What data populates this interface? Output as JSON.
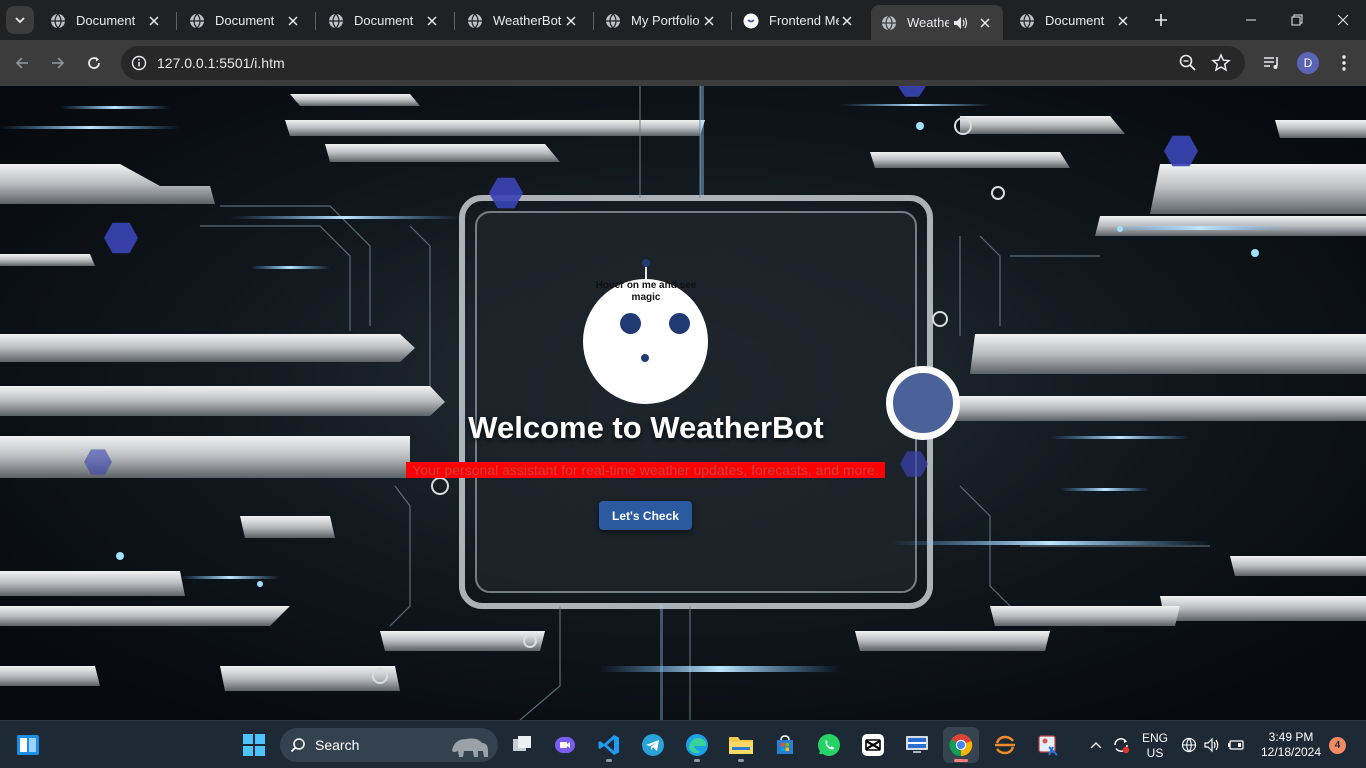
{
  "browser": {
    "tabs": [
      {
        "title": "Document"
      },
      {
        "title": "Document"
      },
      {
        "title": "Document"
      },
      {
        "title": "WeatherBot"
      },
      {
        "title": "My Portfolio"
      },
      {
        "title": "Frontend Me"
      },
      {
        "title": "Weather"
      },
      {
        "title": "Document"
      }
    ],
    "url": "127.0.0.1:5501/i.htm",
    "profile_initial": "D"
  },
  "page": {
    "bot_hint": "Hover on me and see magic",
    "headline": "Welcome to WeatherBot",
    "tagline": "Your personal assistant for real-time weather updates, forecasts, and more.",
    "cta_label": "Let's Check"
  },
  "taskbar": {
    "search_label": "Search",
    "language": "ENG",
    "region": "US",
    "time": "3:49 PM",
    "date": "12/18/2024",
    "notification_count": "4"
  },
  "colors": {
    "accent_button": "#2c5aa0",
    "tagline_bg": "#ff0000",
    "bot_features": "#203a73"
  }
}
